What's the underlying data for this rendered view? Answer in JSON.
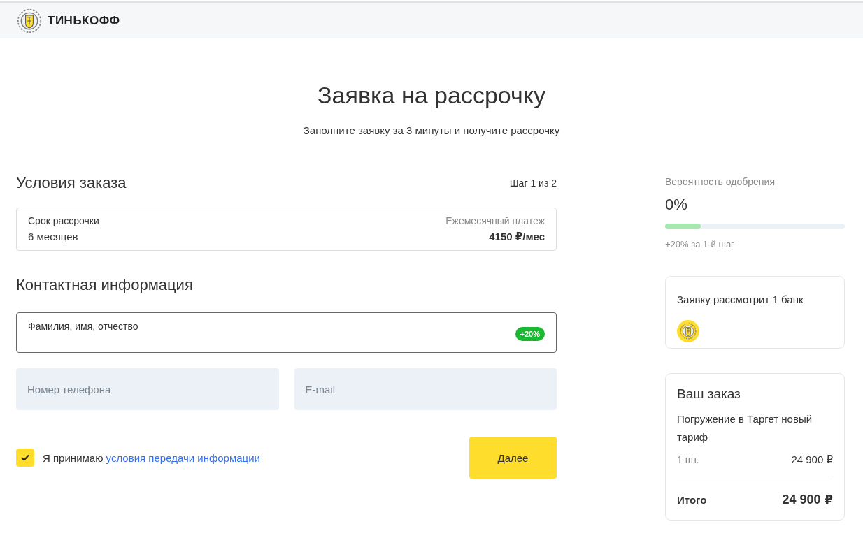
{
  "header": {
    "brand": "ТИНЬКОФФ"
  },
  "page": {
    "title": "Заявка на рассрочку",
    "subtitle": "Заполните заявку за 3 минуты и получите рассрочку"
  },
  "order_terms": {
    "heading": "Условия заказа",
    "step": "Шаг 1 из 2",
    "term_label": "Срок рассрочки",
    "term_value": "6 месяцев",
    "payment_label": "Ежемесячный платеж",
    "payment_value": "4150 ₽/мес"
  },
  "contact": {
    "heading": "Контактная информация",
    "name_field": {
      "label": "Фамилия, имя, отчество",
      "badge": "+20%",
      "focused": true
    },
    "fields": [
      {
        "placeholder": "Номер телефона"
      },
      {
        "placeholder": "E-mail"
      }
    ]
  },
  "consent": {
    "checked": true,
    "text": "Я принимаю",
    "link": "условия передачи информации"
  },
  "next_button": "Далее",
  "approval": {
    "label": "Вероятность одобрения",
    "value": "0%",
    "level": 0.2,
    "hint": "+20% за 1-й шаг"
  },
  "banks": {
    "text": "Заявку рассмотрит 1 банк"
  },
  "your_order": {
    "heading": "Ваш заказ",
    "product": "Погружение в Таргет новый тариф",
    "qty": "1 шт.",
    "price": "24 900 ₽",
    "total_label": "Итого",
    "total": "24 900 ₽"
  }
}
